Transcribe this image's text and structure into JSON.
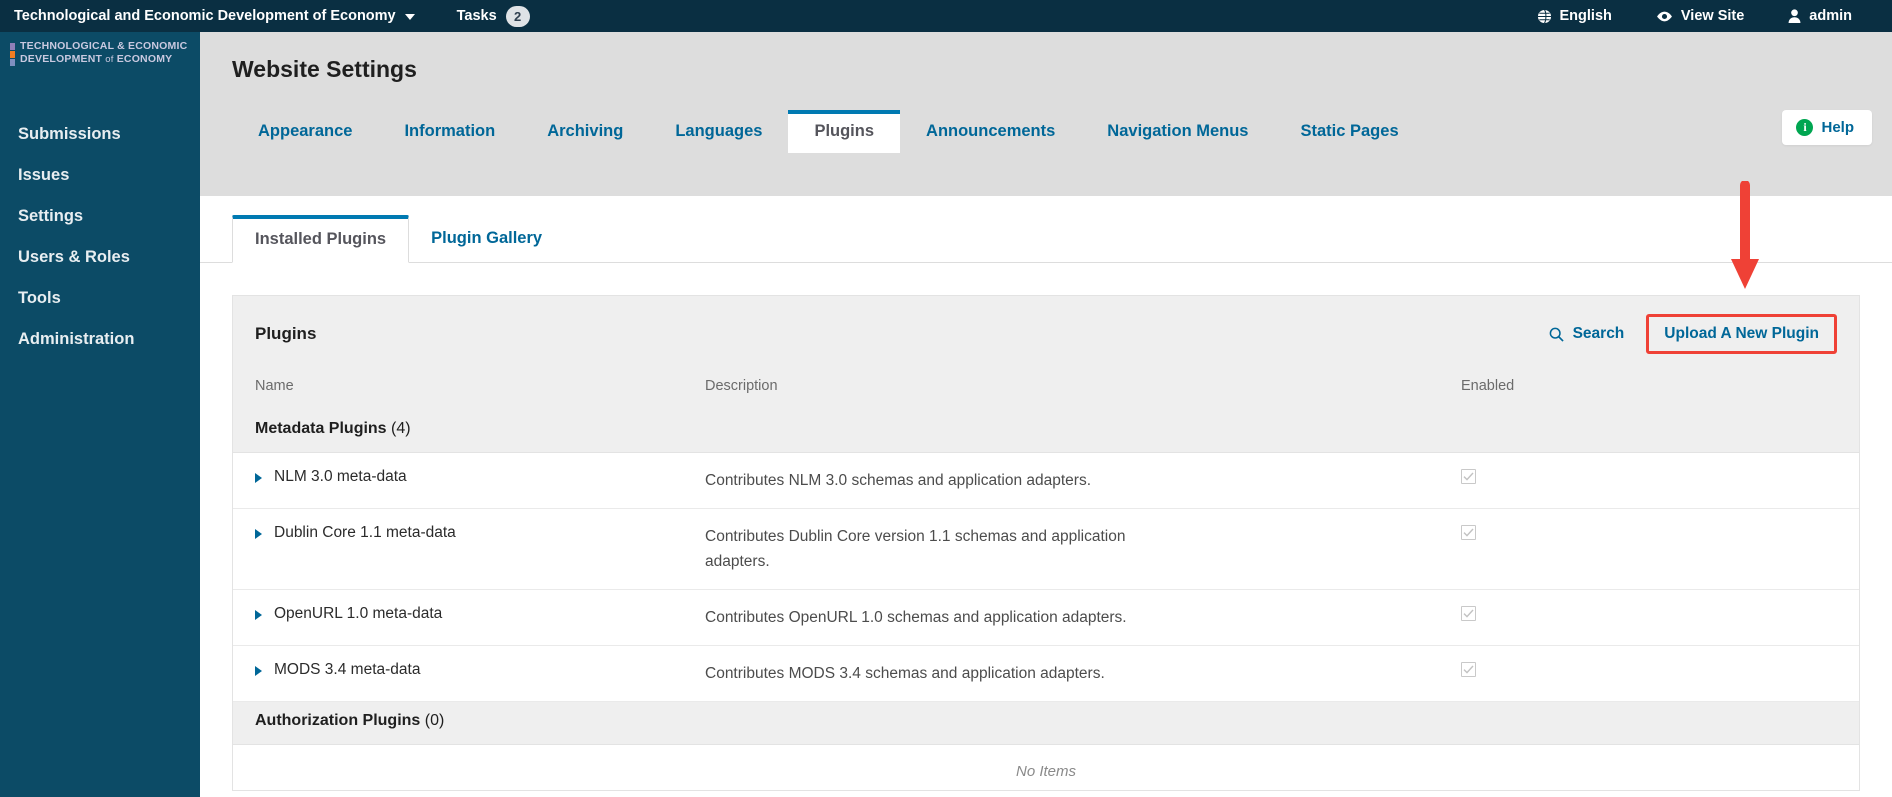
{
  "topbar": {
    "journal_title": "Technological and Economic Development of Economy",
    "journal_dropdown_icon": "chevron-down-icon",
    "tasks_label": "Tasks",
    "tasks_count": "2",
    "language_label": "English",
    "language_icon": "globe-icon",
    "view_site_label": "View Site",
    "view_site_icon": "eye-icon",
    "user_label": "admin",
    "user_icon": "user-icon"
  },
  "sidebar": {
    "brand_line1": "TECHNOLOGICAL & ECONOMIC",
    "brand_line2_a": "DEVELOPMENT",
    "brand_line2_b": "of",
    "brand_line2_c": "ECONOMY",
    "brand_block_colors": [
      "#8f7fb8",
      "#f07d22",
      "#7f8fc0"
    ],
    "items": [
      {
        "label": "Submissions"
      },
      {
        "label": "Issues"
      },
      {
        "label": "Settings"
      },
      {
        "label": "Users & Roles"
      },
      {
        "label": "Tools"
      },
      {
        "label": "Administration"
      }
    ]
  },
  "main": {
    "page_title": "Website Settings",
    "help_label": "Help",
    "help_icon": "info-icon",
    "tabs": [
      {
        "label": "Appearance",
        "active": false
      },
      {
        "label": "Information",
        "active": false
      },
      {
        "label": "Archiving",
        "active": false
      },
      {
        "label": "Languages",
        "active": false
      },
      {
        "label": "Plugins",
        "active": true
      },
      {
        "label": "Announcements",
        "active": false
      },
      {
        "label": "Navigation Menus",
        "active": false
      },
      {
        "label": "Static Pages",
        "active": false
      }
    ],
    "subtabs": [
      {
        "label": "Installed Plugins",
        "active": true
      },
      {
        "label": "Plugin Gallery",
        "active": false
      }
    ]
  },
  "plugins_card": {
    "title": "Plugins",
    "search_label": "Search",
    "search_icon": "search-icon",
    "upload_label": "Upload A New Plugin",
    "upload_highlight_color": "#ef4136",
    "columns": {
      "name": "Name",
      "description": "Description",
      "enabled": "Enabled"
    },
    "groups": [
      {
        "name": "Metadata Plugins",
        "count": "(4)",
        "rows": [
          {
            "name": "NLM 3.0 meta-data",
            "description": "Contributes NLM 3.0 schemas and application adapters.",
            "enabled": true
          },
          {
            "name": "Dublin Core 1.1 meta-data",
            "description": "Contributes Dublin Core version 1.1 schemas and application adapters.",
            "enabled": true
          },
          {
            "name": "OpenURL 1.0 meta-data",
            "description": "Contributes OpenURL 1.0 schemas and application adapters.",
            "enabled": true
          },
          {
            "name": "MODS 3.4 meta-data",
            "description": "Contributes MODS 3.4 schemas and application adapters.",
            "enabled": true
          }
        ]
      },
      {
        "name": "Authorization Plugins",
        "count": "(0)",
        "rows": [],
        "empty_label": "No Items"
      }
    ]
  },
  "annotation": {
    "arrow_color": "#ef4136",
    "arrow_direction": "down",
    "points_to": "Upload A New Plugin"
  }
}
